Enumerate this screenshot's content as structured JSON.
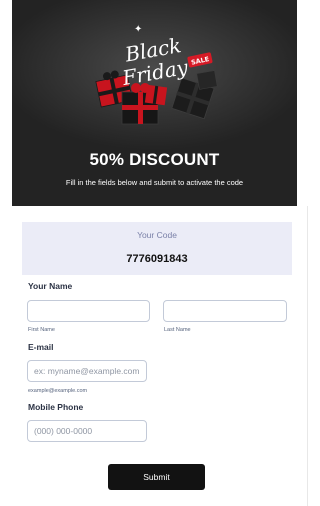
{
  "hero": {
    "logo_line1": "Black",
    "logo_line2": "Friday",
    "logo_sale_tag": "SALE",
    "title": "50% DISCOUNT",
    "subtitle": "Fill in the fields below and submit to activate the code"
  },
  "code": {
    "label": "Your Code",
    "value": "7776091843"
  },
  "form": {
    "name_label": "Your Name",
    "first_name_value": "",
    "first_name_sublabel": "First Name",
    "last_name_value": "",
    "last_name_sublabel": "Last Name",
    "email_label": "E-mail",
    "email_placeholder": "ex: myname@example.com",
    "email_sublabel": "example@example.com",
    "phone_label": "Mobile Phone",
    "phone_placeholder": "(000) 000-0000",
    "submit_label": "Submit"
  },
  "colors": {
    "hero_bg": "#232323",
    "code_box_bg": "#ebecf7",
    "gift_red": "#c8141e",
    "button_bg": "#121212"
  }
}
